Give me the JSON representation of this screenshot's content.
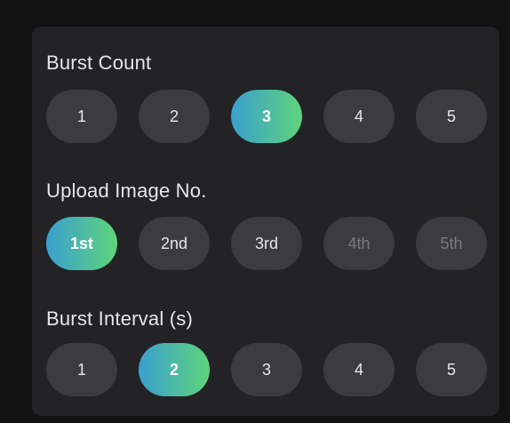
{
  "colors": {
    "accent_gradient_start": "#3a9fcf",
    "accent_gradient_end": "#5fd47a",
    "pill_background": "#3c3c40",
    "panel_background": "#232326"
  },
  "sections": [
    {
      "title": "Burst Count",
      "options": [
        {
          "label": "1",
          "state": "normal"
        },
        {
          "label": "2",
          "state": "normal"
        },
        {
          "label": "3",
          "state": "selected"
        },
        {
          "label": "4",
          "state": "normal"
        },
        {
          "label": "5",
          "state": "normal"
        }
      ]
    },
    {
      "title": "Upload Image No.",
      "options": [
        {
          "label": "1st",
          "state": "selected"
        },
        {
          "label": "2nd",
          "state": "normal"
        },
        {
          "label": "3rd",
          "state": "normal"
        },
        {
          "label": "4th",
          "state": "disabled"
        },
        {
          "label": "5th",
          "state": "disabled"
        }
      ]
    },
    {
      "title": "Burst Interval (s)",
      "options": [
        {
          "label": "1",
          "state": "normal"
        },
        {
          "label": "2",
          "state": "selected"
        },
        {
          "label": "3",
          "state": "normal"
        },
        {
          "label": "4",
          "state": "normal"
        },
        {
          "label": "5",
          "state": "normal"
        }
      ]
    }
  ]
}
